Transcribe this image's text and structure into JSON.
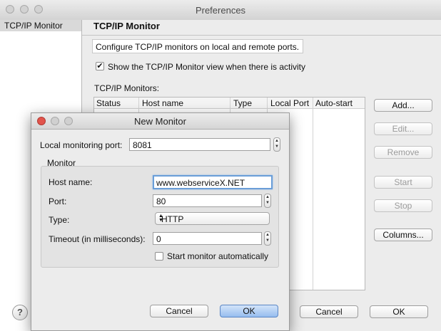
{
  "pref": {
    "title": "Preferences",
    "sidebar_selected": "TCP/IP Monitor",
    "page_title": "TCP/IP Monitor",
    "description": "Configure TCP/IP monitors on local and remote ports.",
    "show_view_label": "Show the TCP/IP Monitor view when there is activity",
    "show_view_checked": true,
    "monitors_label": "TCP/IP Monitors:",
    "columns": [
      "Status",
      "Host name",
      "Type",
      "Local Port",
      "Auto-start"
    ],
    "buttons": {
      "add": "Add...",
      "edit": "Edit...",
      "remove": "Remove",
      "start": "Start",
      "stop": "Stop",
      "columns": "Columns..."
    },
    "help": "?",
    "cancel": "Cancel",
    "ok": "OK"
  },
  "dialog": {
    "title": "New Monitor",
    "local_port_label": "Local monitoring port:",
    "local_port_value": "8081",
    "group_label": "Monitor",
    "host_label": "Host name:",
    "host_value": "www.webserviceX.NET",
    "port_label": "Port:",
    "port_value": "80",
    "type_label": "Type:",
    "type_value": "HTTP",
    "timeout_label": "Timeout (in milliseconds):",
    "timeout_value": "0",
    "auto_start_label": "Start monitor automatically",
    "auto_start_checked": false,
    "cancel": "Cancel",
    "ok": "OK"
  },
  "colors": {
    "close_red": "#e2544c",
    "focus_blue": "#6a9ed8",
    "primary_button": "#96bdef"
  },
  "icons": {
    "checkmark": "checkmark-icon",
    "stepper": "up-down-arrows-icon",
    "help": "question-mark-icon"
  }
}
